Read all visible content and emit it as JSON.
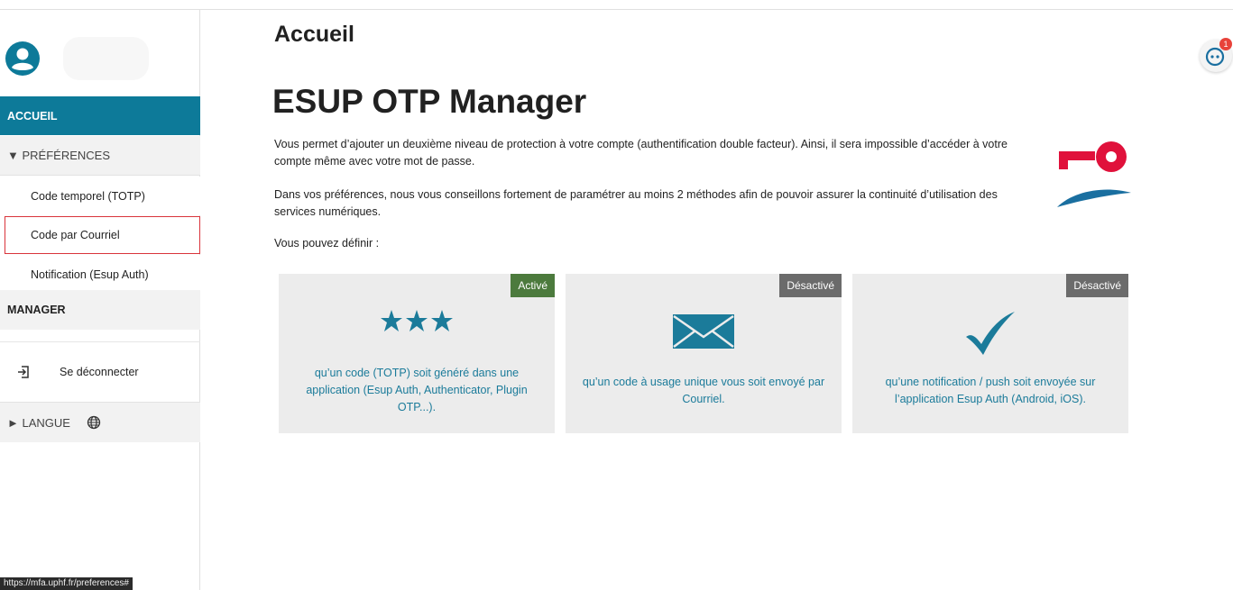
{
  "page": {
    "title": "Accueil",
    "heading": "ESUP OTP Manager"
  },
  "sidebar": {
    "accueil": "ACCUEIL",
    "preferences": "▼ PRÉFÉRENCES",
    "totp": "Code temporel (TOTP)",
    "courriel": "Code par Courriel",
    "notification": "Notification (Esup Auth)",
    "manager": "MANAGER",
    "logout": "Se déconnecter",
    "langue": "► LANGUE"
  },
  "intro": {
    "p1": "Vous permet d’ajouter un deuxième niveau de protection à votre compte (authentification double facteur). Ainsi, il sera impossible d’accéder à votre compte même avec votre mot de passe.",
    "p2": "Dans vos préférences, nous vous conseillons fortement de paramétrer au moins 2 méthodes afin de pouvoir assurer la continuité d’utilisation des services numériques.",
    "p3": "Vous pouvez définir :"
  },
  "cards": [
    {
      "status": "Activé",
      "text": "qu’un code (TOTP) soit généré dans une application (Esup Auth, Authenticator, Plugin OTP...).",
      "icon": "asterisks-icon"
    },
    {
      "status": "Désactivé",
      "text": "qu’un code à usage unique vous soit envoyé par Courriel.",
      "icon": "envelope-icon"
    },
    {
      "status": "Désactivé",
      "text": "qu’une notification / push soit envoyée sur l’application Esup Auth (Android, iOS).",
      "icon": "checkmark-icon"
    }
  ],
  "help": {
    "badge": "1"
  },
  "status_bar": {
    "url": "https://mfa.uphf.fr/preferences#"
  },
  "colors": {
    "accent": "#0d7a99",
    "active": "#4c7a3d",
    "inactive": "#6b6b6b",
    "link": "#1b7b9a",
    "logo_red": "#e0113b"
  }
}
